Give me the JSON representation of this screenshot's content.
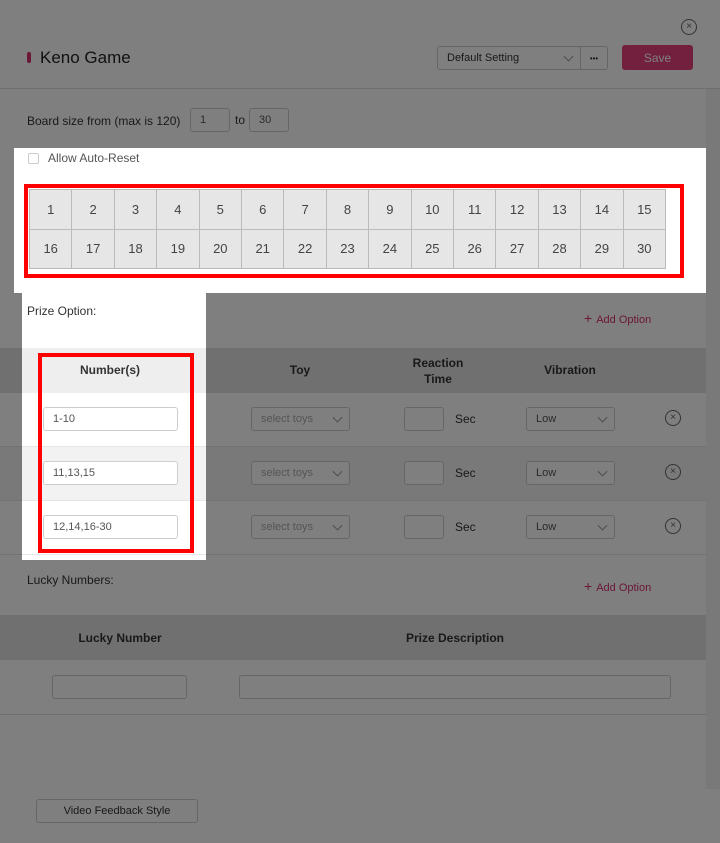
{
  "header": {
    "title": "Keno Game",
    "preset": "Default Setting",
    "more": "•••",
    "save": "Save",
    "accent": "#d62f6e"
  },
  "board": {
    "label": "Board size from (max is 120)",
    "from": "1",
    "to_label": "to",
    "to": "30"
  },
  "auto_reset": {
    "label": "Allow Auto-Reset",
    "checked": false
  },
  "grid": {
    "numbers": [
      1,
      2,
      3,
      4,
      5,
      6,
      7,
      8,
      9,
      10,
      11,
      12,
      13,
      14,
      15,
      16,
      17,
      18,
      19,
      20,
      21,
      22,
      23,
      24,
      25,
      26,
      27,
      28,
      29,
      30
    ]
  },
  "prize": {
    "title": "Prize Option:",
    "add": "Add Option",
    "columns": {
      "numbers": "Number(s)",
      "toy": "Toy",
      "reaction": "Reaction Time",
      "vibration": "Vibration"
    },
    "rows": [
      {
        "numbers": "1-10",
        "toy": "select toys",
        "reaction": "",
        "unit": "Sec",
        "vibration": "Low"
      },
      {
        "numbers": "11,13,15",
        "toy": "select toys",
        "reaction": "",
        "unit": "Sec",
        "vibration": "Low"
      },
      {
        "numbers": "12,14,16-30",
        "toy": "select toys",
        "reaction": "",
        "unit": "Sec",
        "vibration": "Low"
      }
    ]
  },
  "lucky": {
    "title": "Lucky Numbers:",
    "add": "Add Option",
    "columns": {
      "number": "Lucky Number",
      "description": "Prize Description"
    },
    "rows": [
      {
        "number": "",
        "description": ""
      }
    ]
  },
  "footer": {
    "video_button": "Video Feedback Style"
  }
}
